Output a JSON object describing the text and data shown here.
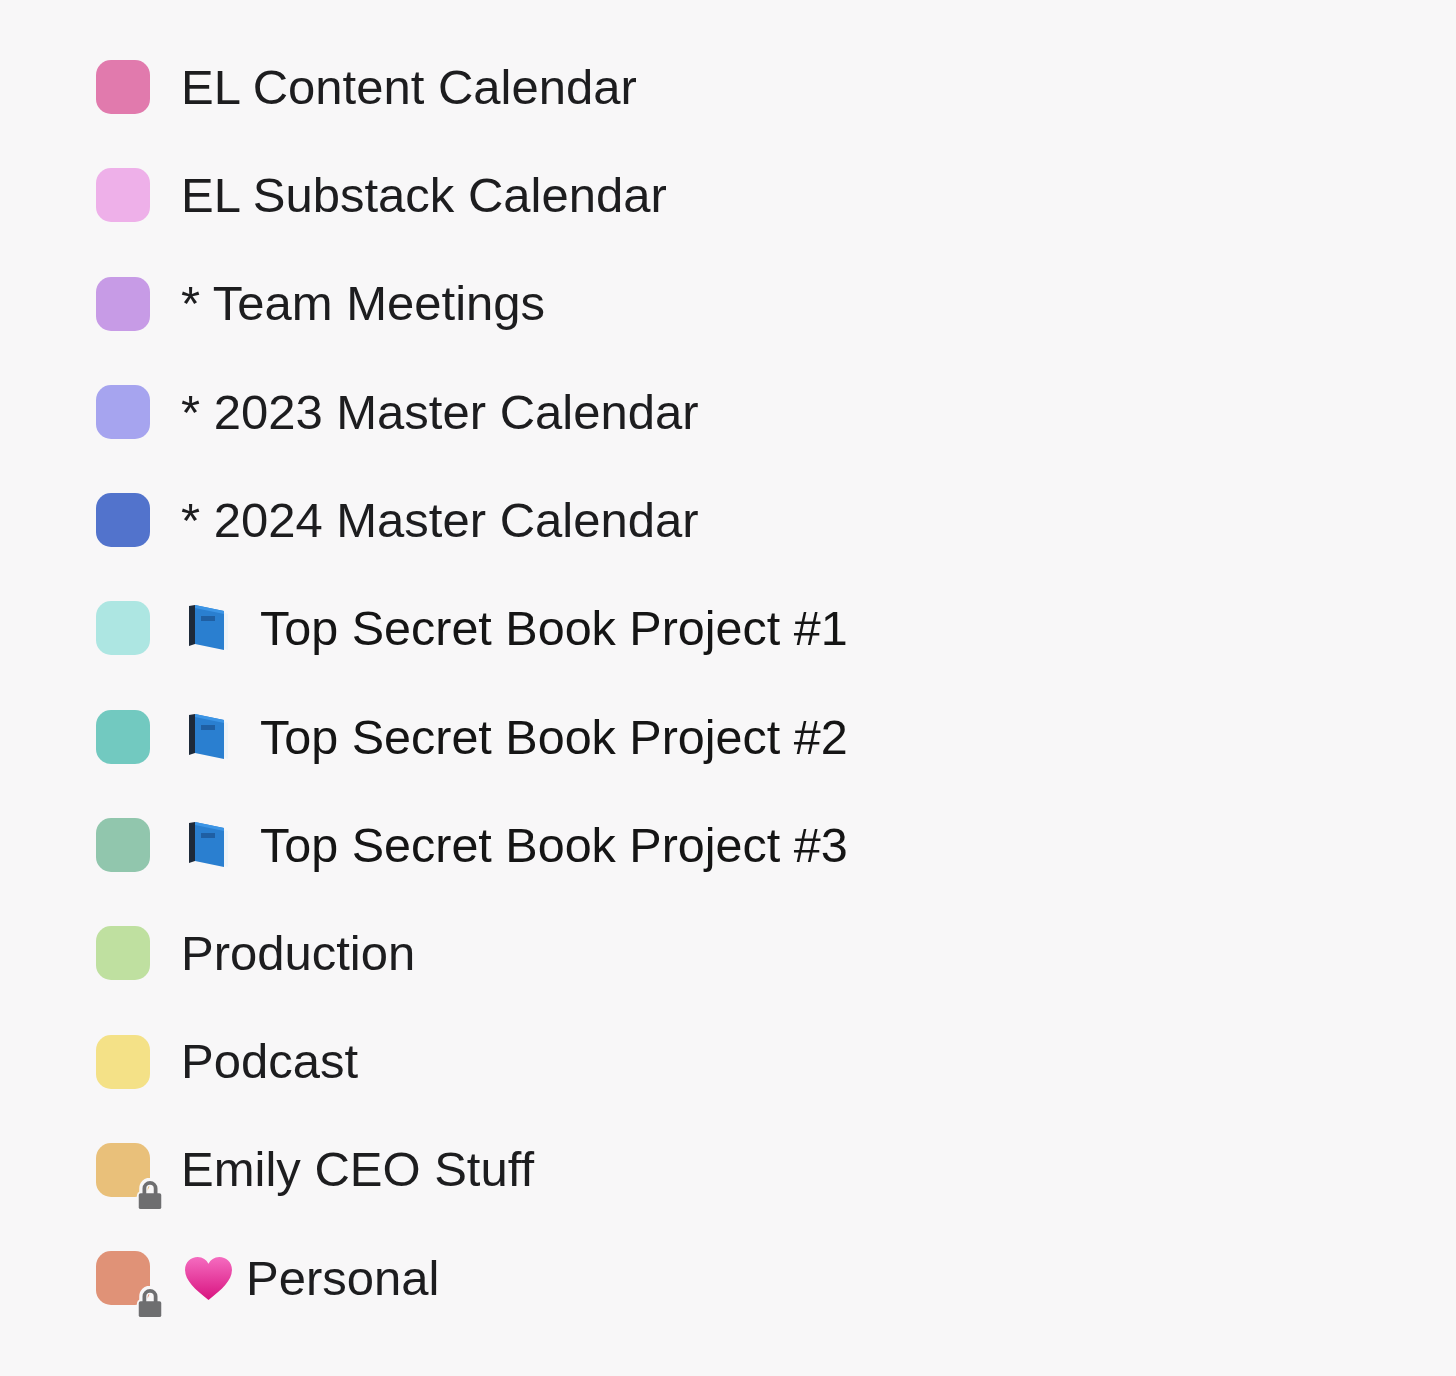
{
  "calendars": [
    {
      "name": "EL Content Calendar",
      "color": "#e17aad",
      "kind": "plain",
      "locked": false
    },
    {
      "name": "EL Substack Calendar",
      "color": "#eeb0e9",
      "kind": "plain",
      "locked": false
    },
    {
      "name": "* Team Meetings",
      "color": "#c79be6",
      "kind": "plain",
      "locked": false
    },
    {
      "name": "* 2023 Master Calendar",
      "color": "#a6a4ef",
      "kind": "plain",
      "locked": false
    },
    {
      "name": "* 2024 Master Calendar",
      "color": "#5273cc",
      "kind": "plain",
      "locked": false
    },
    {
      "name": "Top Secret Book Project #1",
      "color": "#ade6e2",
      "kind": "book",
      "locked": false
    },
    {
      "name": "Top Secret Book Project #2",
      "color": "#72c9c0",
      "kind": "book",
      "locked": false
    },
    {
      "name": "Top Secret Book Project #3",
      "color": "#91c6ad",
      "kind": "book",
      "locked": false
    },
    {
      "name": "Production",
      "color": "#bfe0a0",
      "kind": "plain",
      "locked": false
    },
    {
      "name": "Podcast",
      "color": "#f4e187",
      "kind": "plain",
      "locked": false
    },
    {
      "name": "Emily CEO Stuff",
      "color": "#e9c07a",
      "kind": "plain",
      "locked": true
    },
    {
      "name": "Personal",
      "color": "#e09277",
      "kind": "heart",
      "locked": true
    }
  ]
}
